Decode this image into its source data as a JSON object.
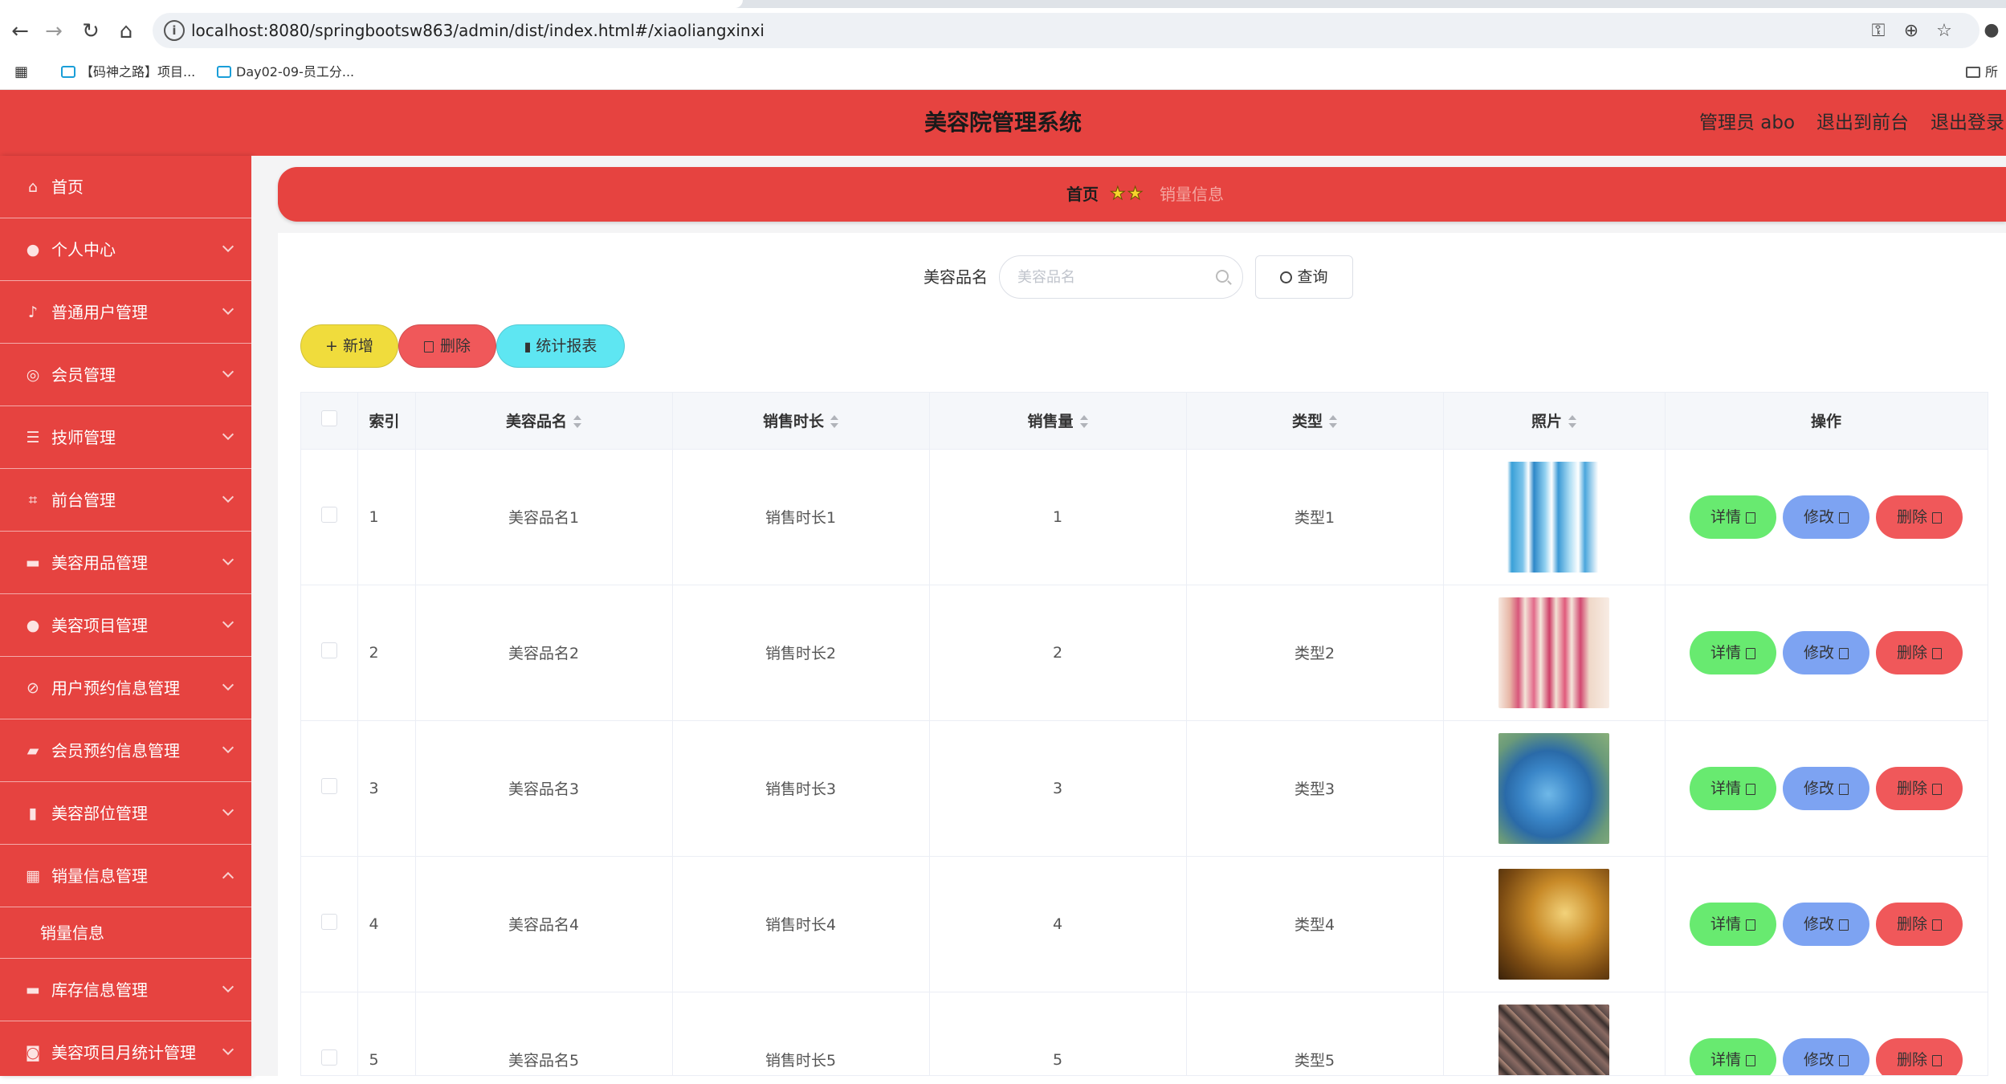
{
  "browser": {
    "url": "localhost:8080/springbootsw863/admin/dist/index.html#/xiaoliangxinxi",
    "bookmarks": [
      "【码神之路】项目...",
      "Day02-09-员工分..."
    ],
    "bookmarks_right": "所"
  },
  "header": {
    "title": "美容院管理系统",
    "admin": "管理员 abo",
    "to_front": "退出到前台",
    "logout": "退出登录"
  },
  "sidebar": {
    "items": [
      {
        "label": "首页",
        "icon": "home-icon",
        "arrow": false
      },
      {
        "label": "个人中心",
        "icon": "user-icon",
        "arrow": true
      },
      {
        "label": "普通用户管理",
        "icon": "microphone-icon",
        "arrow": true
      },
      {
        "label": "会员管理",
        "icon": "aperture-icon",
        "arrow": true
      },
      {
        "label": "技师管理",
        "icon": "sliders-icon",
        "arrow": true
      },
      {
        "label": "前台管理",
        "icon": "crop-icon",
        "arrow": true
      },
      {
        "label": "美容用品管理",
        "icon": "monitor-icon",
        "arrow": true
      },
      {
        "label": "美容项目管理",
        "icon": "user-icon",
        "arrow": true
      },
      {
        "label": "用户预约信息管理",
        "icon": "bell-off-icon",
        "arrow": true
      },
      {
        "label": "会员预约信息管理",
        "icon": "truck-icon",
        "arrow": true
      },
      {
        "label": "美容部位管理",
        "icon": "bar-chart-icon",
        "arrow": true
      },
      {
        "label": "销量信息管理",
        "icon": "grid-icon",
        "arrow": true,
        "expanded": true
      },
      {
        "label": "库存信息管理",
        "icon": "monitor-icon",
        "arrow": true
      },
      {
        "label": "美容项目月统计管理",
        "icon": "camera-icon",
        "arrow": true
      }
    ],
    "subitem": "销量信息"
  },
  "breadcrumb": {
    "home": "首页",
    "stars": "★★",
    "current": "销量信息"
  },
  "search": {
    "label": "美容品名",
    "placeholder": "美容品名",
    "button": "查询"
  },
  "actions": {
    "add": "+ 新增",
    "delete": "删除",
    "stats": "统计报表"
  },
  "table": {
    "headers": {
      "index": "索引",
      "name": "美容品名",
      "duration": "销售时长",
      "volume": "销售量",
      "type": "类型",
      "photo": "照片",
      "ops": "操作"
    },
    "op_labels": {
      "detail": "详情",
      "edit": "修改",
      "delete": "删除"
    },
    "rows": [
      {
        "index": "1",
        "name": "美容品名1",
        "duration": "销售时长1",
        "volume": "1",
        "type": "类型1"
      },
      {
        "index": "2",
        "name": "美容品名2",
        "duration": "销售时长2",
        "volume": "2",
        "type": "类型2"
      },
      {
        "index": "3",
        "name": "美容品名3",
        "duration": "销售时长3",
        "volume": "3",
        "type": "类型3"
      },
      {
        "index": "4",
        "name": "美容品名4",
        "duration": "销售时长4",
        "volume": "4",
        "type": "类型4"
      },
      {
        "index": "5",
        "name": "美容品名5",
        "duration": "销售时长5",
        "volume": "5",
        "type": "类型5"
      }
    ]
  },
  "colors": {
    "accent": "#e64340",
    "add": "#f0dc3c",
    "delete": "#f0585a",
    "stats": "#5ee6f2",
    "detail": "#68ea70",
    "edit": "#7da3f2"
  }
}
